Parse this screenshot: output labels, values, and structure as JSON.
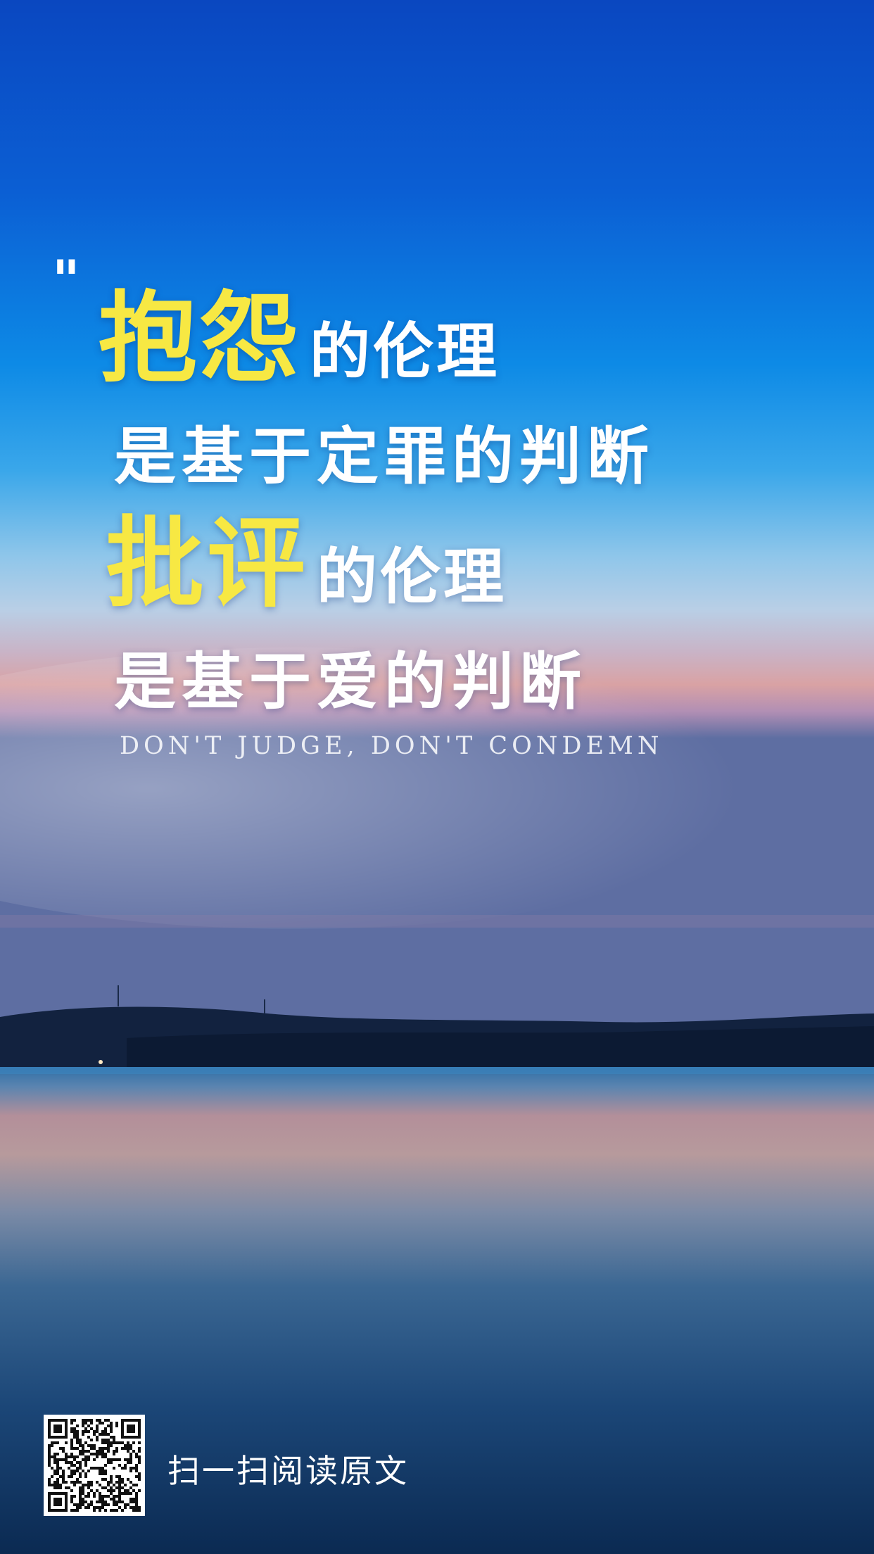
{
  "quote_mark": "\"",
  "headline": {
    "line1": {
      "highlight": "抱怨",
      "rest": "的伦理"
    },
    "line2": "是基于定罪的判断",
    "line3": {
      "highlight": "批评",
      "rest": "的伦理"
    },
    "line4": "是基于爱的判断"
  },
  "subtitle": "DON'T JUDGE, DON'T CONDEMN",
  "footer": {
    "qr_icon": "qr-code-icon",
    "scan_label": "扫一扫阅读原文"
  },
  "colors": {
    "highlight": "#f7e843",
    "text": "#ffffff",
    "sky_top": "#0b4fc4",
    "sky_mid": "#0f8fe6",
    "horizon": "#e8a99a",
    "water_dark": "#0d2e5a"
  }
}
